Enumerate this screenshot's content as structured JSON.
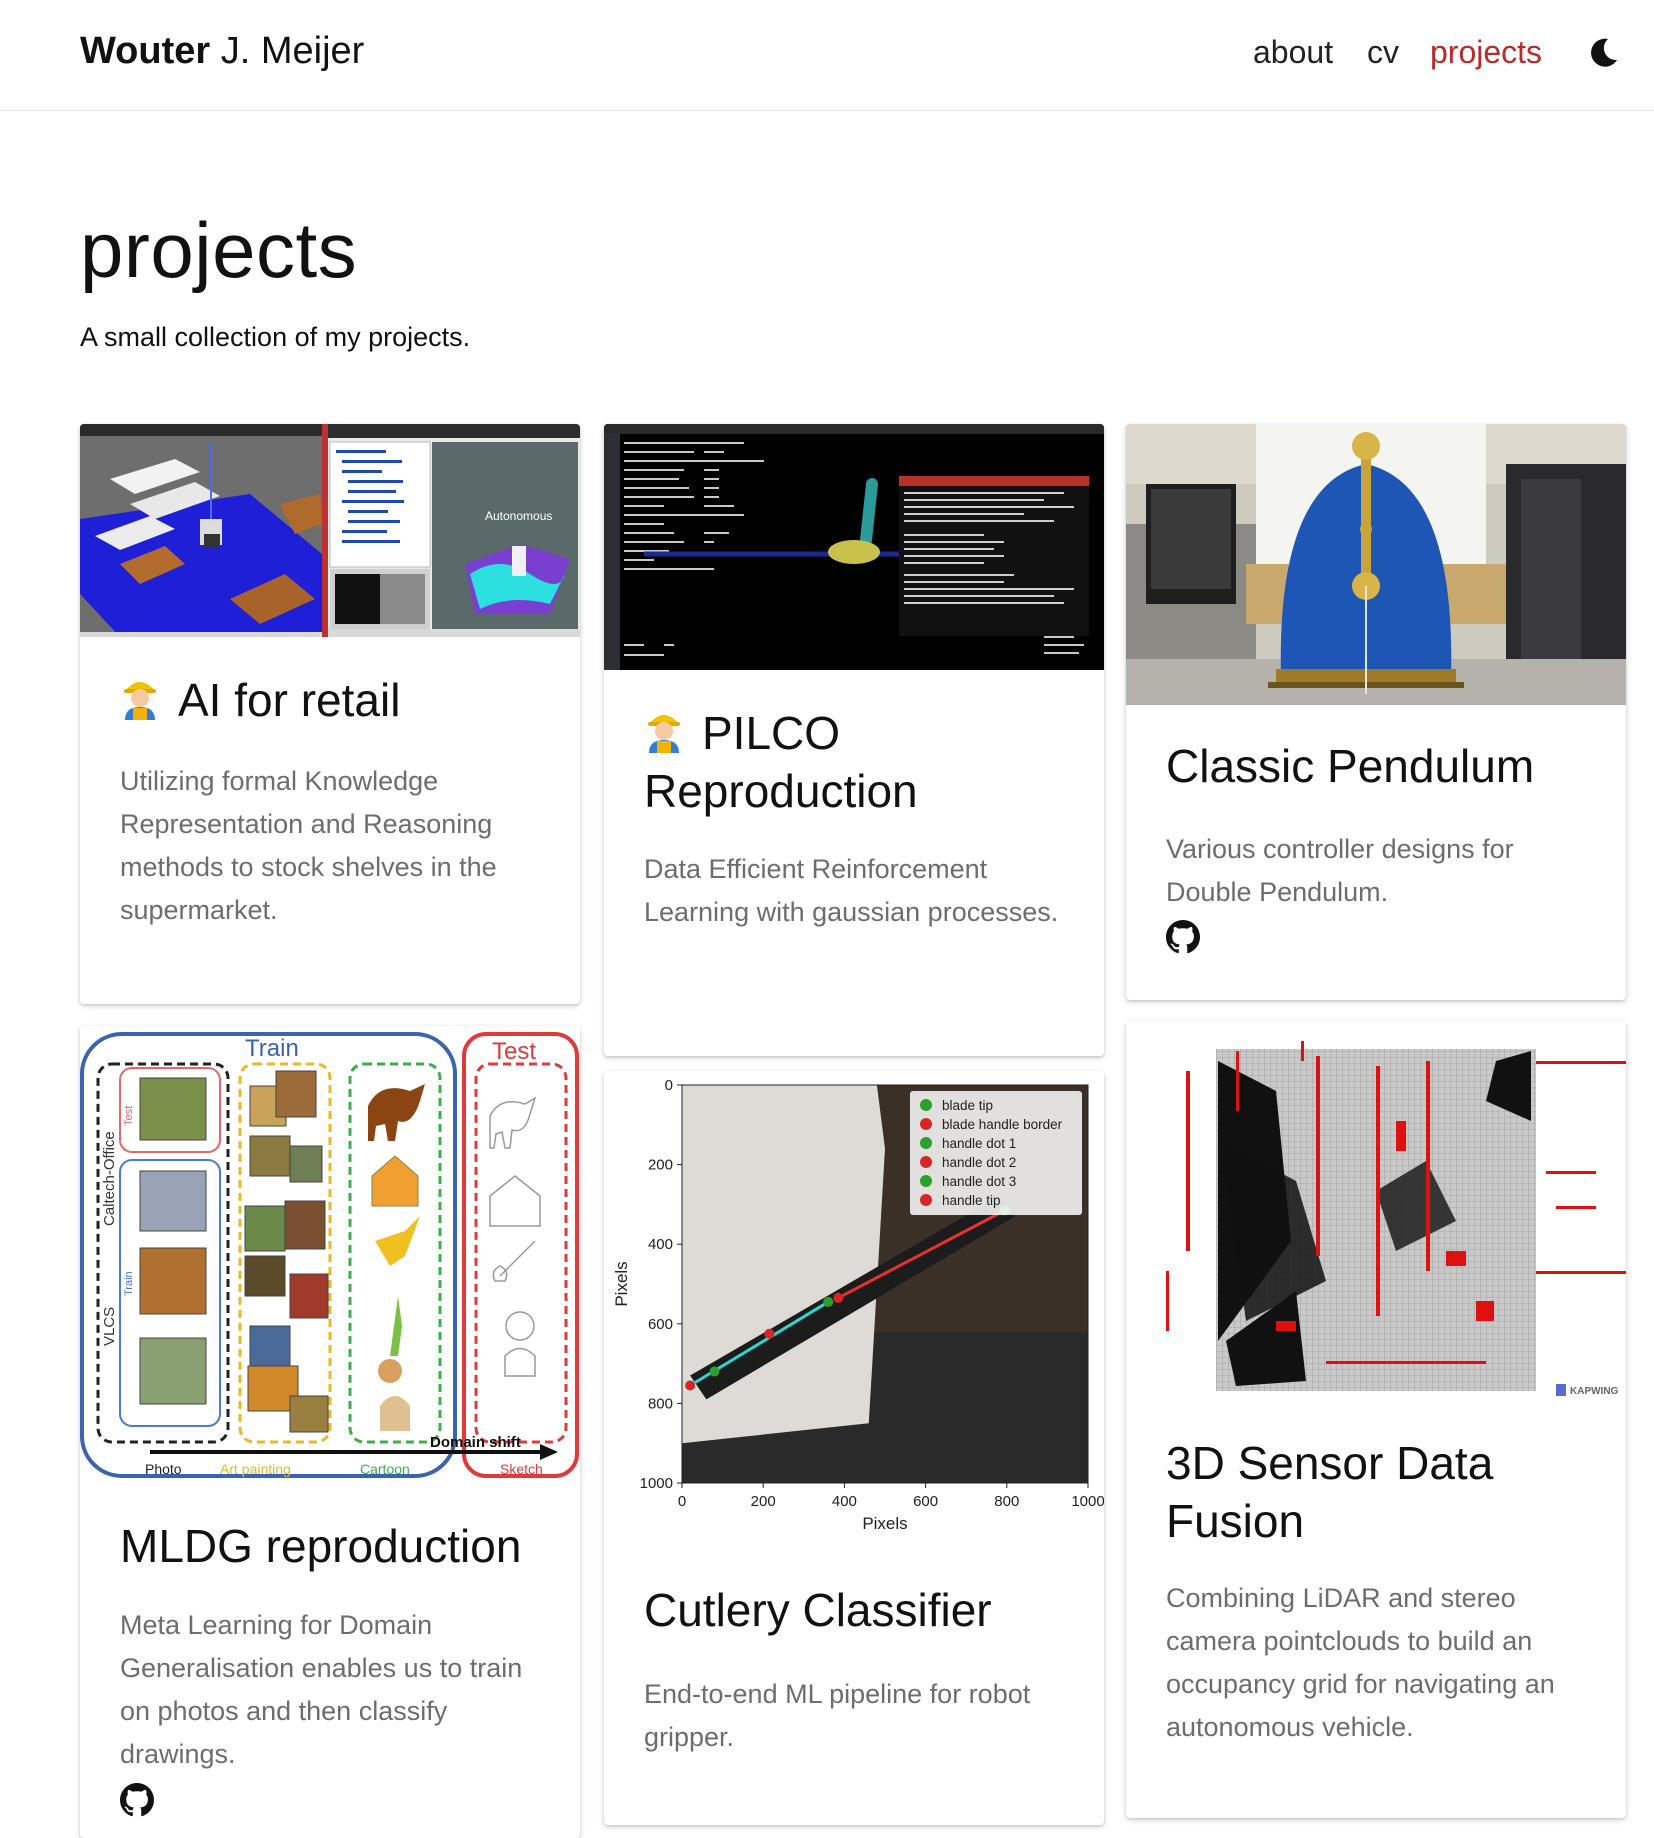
{
  "navbar": {
    "brand_first": "Wouter",
    "brand_rest": " J. Meijer",
    "links": [
      "about",
      "cv",
      "projects"
    ],
    "active": "projects",
    "active_color": "#b52a2a",
    "theme_icon": "moon-icon"
  },
  "header": {
    "title": "projects",
    "description": "A small collection of my projects."
  },
  "projects": [
    {
      "title": "AI for retail",
      "description": "Utilizing formal Knowledge Representation and Reasoning methods to stock shelves in the supermarket.",
      "emoji": "construction-worker-emoji",
      "thumb_label": "Autonomous"
    },
    {
      "title": "PILCO Reproduction",
      "description": "Data Efficient Reinforcement Learning with gaussian processes.",
      "emoji": "construction-worker-emoji"
    },
    {
      "title": "Classic Pendulum",
      "description": "Various controller designs for Double Pendulum.",
      "link_icon": "github-icon"
    },
    {
      "title": "MLDG reproduction",
      "description": "Meta Learning for Domain Generalisation enables us to train on photos and then classify drawings.",
      "link_icon": "github-icon",
      "thumb": {
        "train_label": "Train",
        "test_label": "Test",
        "left_labels": [
          "Caltech-Office",
          "VLCS",
          "Test",
          "Train"
        ],
        "domains": [
          "Photo",
          "Art painting",
          "Cartoon",
          "Sketch"
        ],
        "arrow_label": "Domain shift"
      }
    },
    {
      "title": "Cutlery Classifier",
      "description": "End-to-end ML pipeline for robot gripper."
    },
    {
      "title": "3D Sensor Data Fusion",
      "description": "Combining LiDAR and stereo camera pointclouds to build an occupancy grid for navigating an autonomous vehicle.",
      "thumb_watermark": "KAPWING"
    }
  ],
  "chart_data": {
    "type": "scatter",
    "xlabel": "Pixels",
    "ylabel": "Pixels",
    "xlim": [
      0,
      1000
    ],
    "ylim": [
      1000,
      0
    ],
    "xticks": [
      0,
      200,
      400,
      600,
      800,
      1000
    ],
    "yticks": [
      0,
      200,
      400,
      600,
      800,
      1000
    ],
    "legend_position": "top-right",
    "series": [
      {
        "name": "blade tip",
        "color": "#2ca02c",
        "points": [
          [
            795,
            315
          ]
        ]
      },
      {
        "name": "blade handle border",
        "color": "#d62728",
        "points": [
          [
            385,
            535
          ]
        ]
      },
      {
        "name": "handle dot 1",
        "color": "#2ca02c",
        "points": [
          [
            360,
            545
          ]
        ]
      },
      {
        "name": "handle dot 2",
        "color": "#d62728",
        "points": [
          [
            215,
            625
          ]
        ]
      },
      {
        "name": "handle dot 3",
        "color": "#2ca02c",
        "points": [
          [
            80,
            720
          ]
        ]
      },
      {
        "name": "handle tip",
        "color": "#d62728",
        "points": [
          [
            20,
            755
          ]
        ]
      }
    ]
  }
}
